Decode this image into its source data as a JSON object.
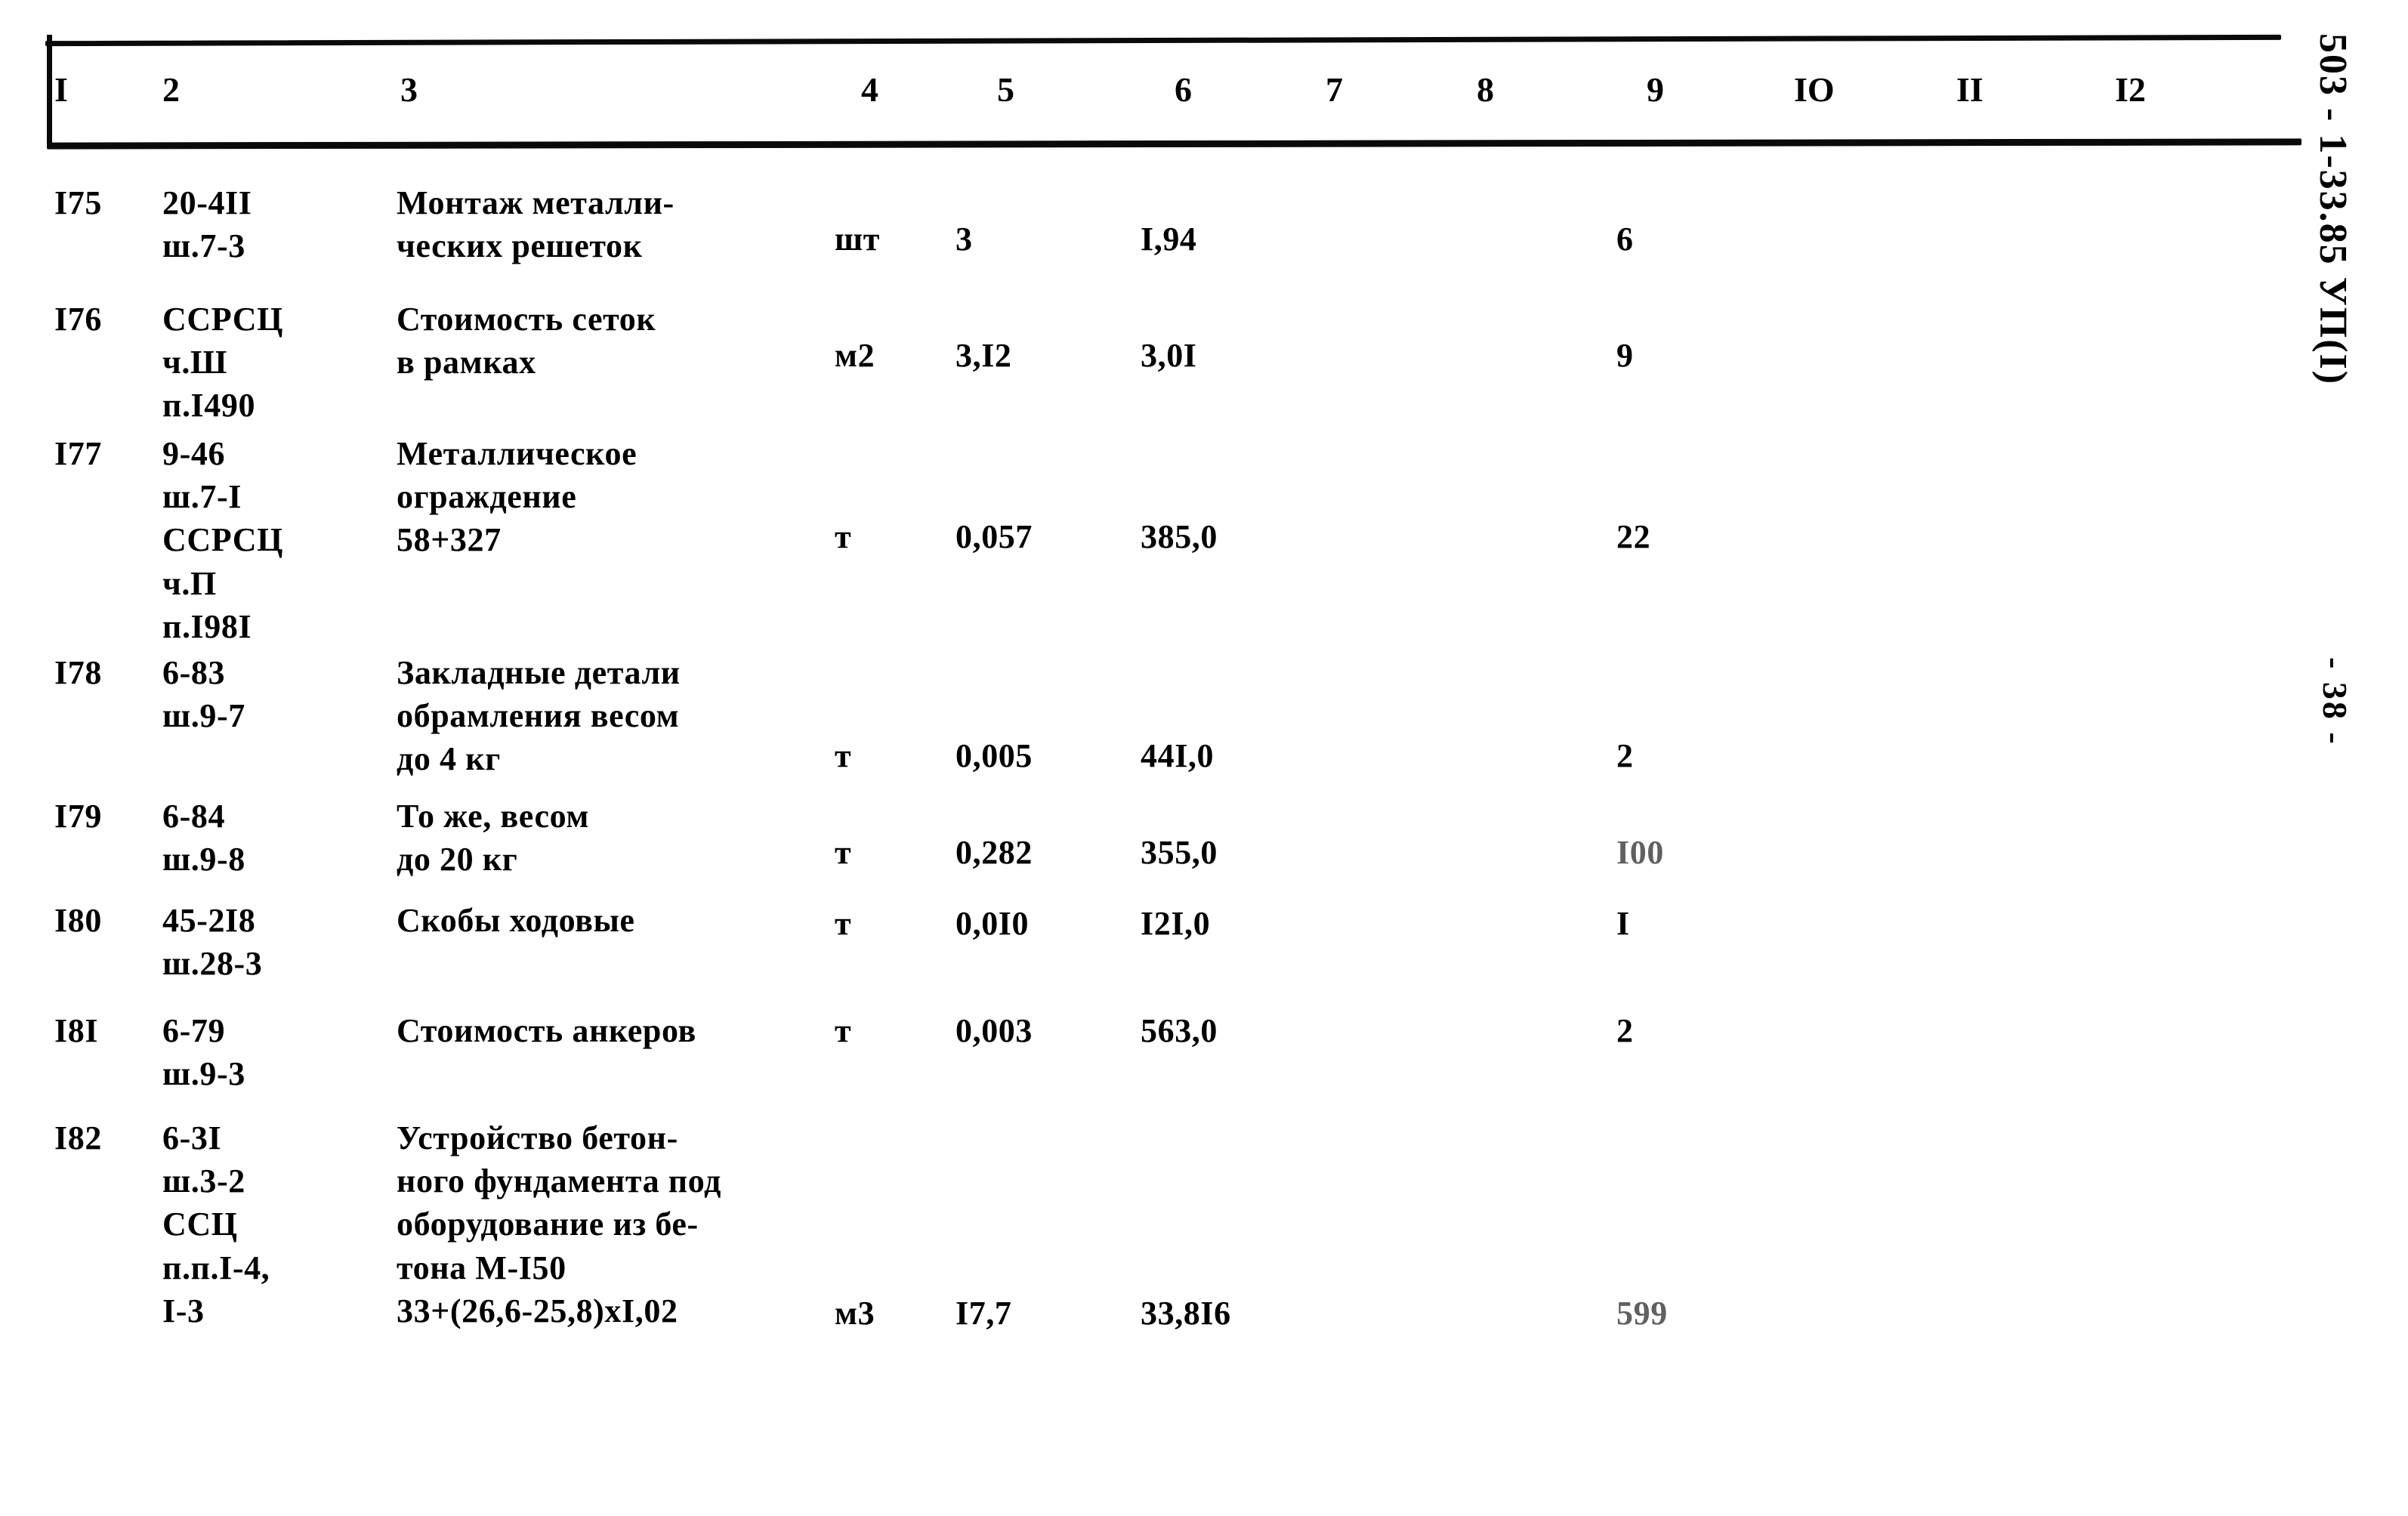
{
  "document": {
    "side_code": "503 - 1-33.85 УП(I)",
    "page_marker": "- 38 -"
  },
  "table": {
    "column_headers": [
      "I",
      "2",
      "3",
      "4",
      "5",
      "6",
      "7",
      "8",
      "9",
      "IO",
      "II",
      "I2"
    ],
    "rows": [
      {
        "c1": "I75",
        "c2": "20-4II\nш.7-3",
        "c3": "Монтаж металли-\nческих решеток",
        "c4": "шт",
        "c5": "3",
        "c6": "I,94",
        "c7": "",
        "c8": "",
        "c9": "6",
        "c10": "",
        "c11": "",
        "c12": ""
      },
      {
        "c1": "I76",
        "c2": "ССРСЦ\nч.Ш\nп.I490",
        "c3": "Стоимость сеток\nв рамках",
        "c4": "м2",
        "c5": "3,I2",
        "c6": "3,0I",
        "c7": "",
        "c8": "",
        "c9": "9",
        "c10": "",
        "c11": "",
        "c12": ""
      },
      {
        "c1": "I77",
        "c2": "9-46\nш.7-I\nССРСЦ\nч.П\nп.I98I",
        "c3": "Металлическое\nограждение\n58+327",
        "c4": "т",
        "c5": "0,057",
        "c6": "385,0",
        "c7": "",
        "c8": "",
        "c9": "22",
        "c10": "",
        "c11": "",
        "c12": ""
      },
      {
        "c1": "I78",
        "c2": "6-83\nш.9-7",
        "c3": "Закладные детали\nобрамления весом\nдо 4 кг",
        "c4": "т",
        "c5": "0,005",
        "c6": "44I,0",
        "c7": "",
        "c8": "",
        "c9": "2",
        "c10": "",
        "c11": "",
        "c12": ""
      },
      {
        "c1": "I79",
        "c2": "6-84\nш.9-8",
        "c3": "То же, весом\nдо 20 кг",
        "c4": "т",
        "c5": "0,282",
        "c6": "355,0",
        "c7": "",
        "c8": "",
        "c9": "I00",
        "c10": "",
        "c11": "",
        "c12": ""
      },
      {
        "c1": "I80",
        "c2": "45-2I8\nш.28-3",
        "c3": "Скобы ходовые",
        "c4": "т",
        "c5": "0,0I0",
        "c6": "I2I,0",
        "c7": "",
        "c8": "",
        "c9": "I",
        "c10": "",
        "c11": "",
        "c12": ""
      },
      {
        "c1": "I8I",
        "c2": "6-79\nш.9-3",
        "c3": "Стоимость анкеров",
        "c4": "т",
        "c5": "0,003",
        "c6": "563,0",
        "c7": "",
        "c8": "",
        "c9": "2",
        "c10": "",
        "c11": "",
        "c12": ""
      },
      {
        "c1": "I82",
        "c2": "6-3I\nш.3-2\nССЦ\nп.п.I-4,\nI-3",
        "c3": "Устройство бетон-\nного фундамента под\nоборудование из бе-\nтона М-I50\n33+(26,6-25,8)хI,02",
        "c4": "м3",
        "c5": "I7,7",
        "c6": "33,8I6",
        "c7": "",
        "c8": "",
        "c9": "599",
        "c10": "",
        "c11": "",
        "c12": ""
      }
    ]
  }
}
